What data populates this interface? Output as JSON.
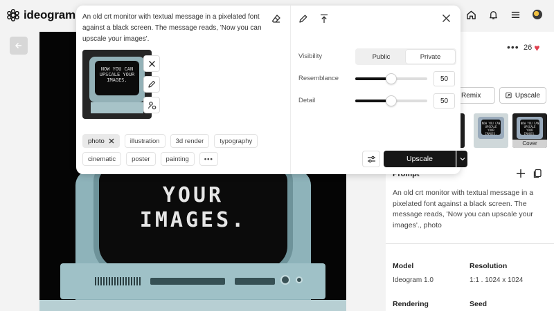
{
  "app": {
    "logo_text": "ideogram"
  },
  "popup": {
    "prompt": "An old crt monitor with textual message in a pixelated font against a black screen. The message reads, 'Now you can upscale your images'.",
    "preview_text": "NOW YOU CAN UPSCALE YOUR IMAGES.",
    "tags": [
      {
        "label": "photo",
        "selected": true
      },
      {
        "label": "illustration",
        "selected": false
      },
      {
        "label": "3d render",
        "selected": false
      },
      {
        "label": "typography",
        "selected": false
      },
      {
        "label": "cinematic",
        "selected": false
      },
      {
        "label": "poster",
        "selected": false
      },
      {
        "label": "painting",
        "selected": false
      }
    ],
    "visibility_label": "Visibility",
    "visibility_options": [
      "Public",
      "Private"
    ],
    "visibility_selected": "Private",
    "resemblance_label": "Resemblance",
    "resemblance_value": "50",
    "detail_label": "Detail",
    "detail_value": "50",
    "upscale_label": "Upscale"
  },
  "image": {
    "text_line1": "YOUR",
    "text_line2": "IMAGES."
  },
  "panel": {
    "likes": "26",
    "remix_label": "Remix",
    "upscale_label": "Upscale",
    "thumb_text": "NOW YOU CAN UPSCALE YOUR IMAGES.",
    "cover_label": "Cover",
    "prompt_label": "Prompt",
    "prompt_text": "An old crt monitor with textual message in a pixelated font against a black screen. The message reads, 'Now you can upscale your images'., photo",
    "model_label": "Model",
    "model_value": "Ideogram 1.0",
    "resolution_label": "Resolution",
    "resolution_value": "1:1 . 1024 x 1024",
    "rendering_label": "Rendering",
    "seed_label": "Seed"
  },
  "colors": {
    "accent": "#161616",
    "heart": "#e0404f"
  }
}
